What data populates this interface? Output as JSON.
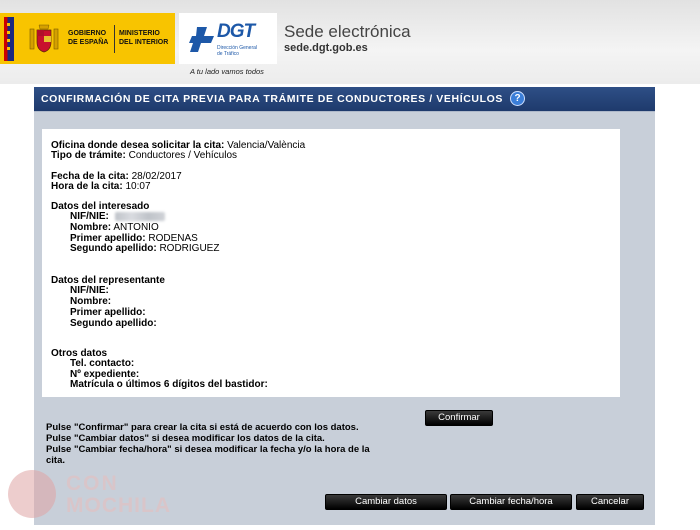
{
  "header": {
    "gob_line1": "GOBIERNO",
    "gob_line2": "DE ESPAÑA",
    "min_line1": "MINISTERIO",
    "min_line2": "DEL INTERIOR",
    "dgt_logo": "DGT",
    "dgt_sub1": "Dirección General",
    "dgt_sub2": "de Tráfico",
    "dgt_tagline": "A tu lado vamos todos",
    "sede_title": "Sede electrónica",
    "sede_url": "sede.dgt.gob.es"
  },
  "page": {
    "title": "CONFIRMACIÓN DE CITA PREVIA PARA TRÁMITE DE CONDUCTORES / VEHÍCULOS",
    "help_icon_text": "?"
  },
  "details": {
    "oficina_label": "Oficina donde desea solicitar la cita:",
    "oficina_value": "Valencia/València",
    "tramite_label": "Tipo de trámite:",
    "tramite_value": "Conductores / Vehículos",
    "fecha_label": "Fecha de la cita:",
    "fecha_value": "28/02/2017",
    "hora_label": "Hora de la cita:",
    "hora_value": "10:07",
    "interesado_heading": "Datos del interesado",
    "nif_label": "NIF/NIE:",
    "nombre_label": "Nombre:",
    "nombre_value": "ANTONIO",
    "primer_label": "Primer apellido:",
    "primer_value": "RODENAS",
    "segundo_label": "Segundo apellido:",
    "segundo_value": "RODRIGUEZ",
    "representante_heading": "Datos del representante",
    "rep_nif_label": "NIF/NIE:",
    "rep_nombre_label": "Nombre:",
    "rep_primer_label": "Primer apellido:",
    "rep_segundo_label": "Segundo apellido:",
    "otros_heading": "Otros datos",
    "tel_label": "Tel. contacto:",
    "expediente_label": "Nº expediente:",
    "matricula_label": "Matrícula o últimos 6 dígitos del bastidor:"
  },
  "instructions": [
    "Pulse \"Confirmar\" para crear la cita si está de acuerdo con los datos.",
    "Pulse \"Cambiar datos\" si desea modificar los datos de la cita.",
    "Pulse \"Cambiar fecha/hora\" si desea modificar la fecha y/o la hora de la",
    "cita."
  ],
  "buttons": {
    "confirmar": "Confirmar",
    "cambiar_datos": "Cambiar datos",
    "cambiar_fecha": "Cambiar fecha/hora",
    "cancelar": "Cancelar"
  },
  "watermark": {
    "line1": "CON",
    "line2": "MOCHILA"
  },
  "colors": {
    "title_bar": "#1e3a6c",
    "panel_bg": "#c8cfd9",
    "gov_yellow": "#f8c400",
    "dgt_blue": "#1d58a8"
  }
}
